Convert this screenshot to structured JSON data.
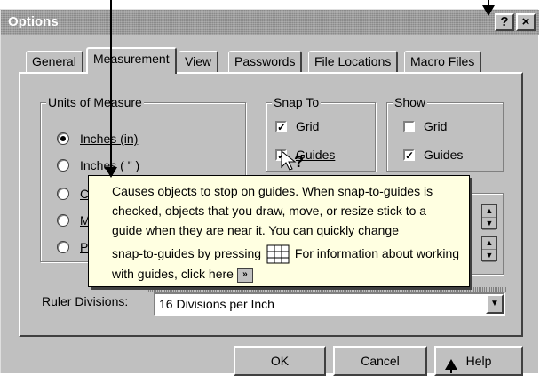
{
  "window": {
    "title": "Options",
    "help_btn": "?",
    "close_btn": "×"
  },
  "tabs": [
    {
      "label": "General"
    },
    {
      "label": "Measurement"
    },
    {
      "label": "View"
    },
    {
      "label": "Passwords"
    },
    {
      "label": "File Locations"
    },
    {
      "label": "Macro Files"
    }
  ],
  "units": {
    "legend": "Units of Measure",
    "options": [
      {
        "label": "Inches (in)",
        "checked": true
      },
      {
        "label": "Inches ( \" )",
        "checked": false
      },
      {
        "label": "C",
        "checked": false
      },
      {
        "label": "M",
        "checked": false
      },
      {
        "label": "P",
        "checked": false
      }
    ]
  },
  "snap": {
    "legend": "Snap To",
    "grid": "Grid",
    "guides": "Guides"
  },
  "show": {
    "legend": "Show",
    "grid": "Grid",
    "guides": "Guides"
  },
  "ruler": {
    "label": "Ruler Divisions:",
    "value": "16 Divisions per Inch"
  },
  "buttons": {
    "ok": "OK",
    "cancel": "Cancel",
    "help": "Help"
  },
  "tooltip": {
    "line1": "Causes objects to stop on guides. When snap-to-guides is checked, objects that you draw, move, or resize stick to a guide when they are near it. You can quickly change",
    "line2a": "snap-to-guides by pressing",
    "line2b": "For information about working with guides, click here",
    "link_glyph": "»"
  }
}
